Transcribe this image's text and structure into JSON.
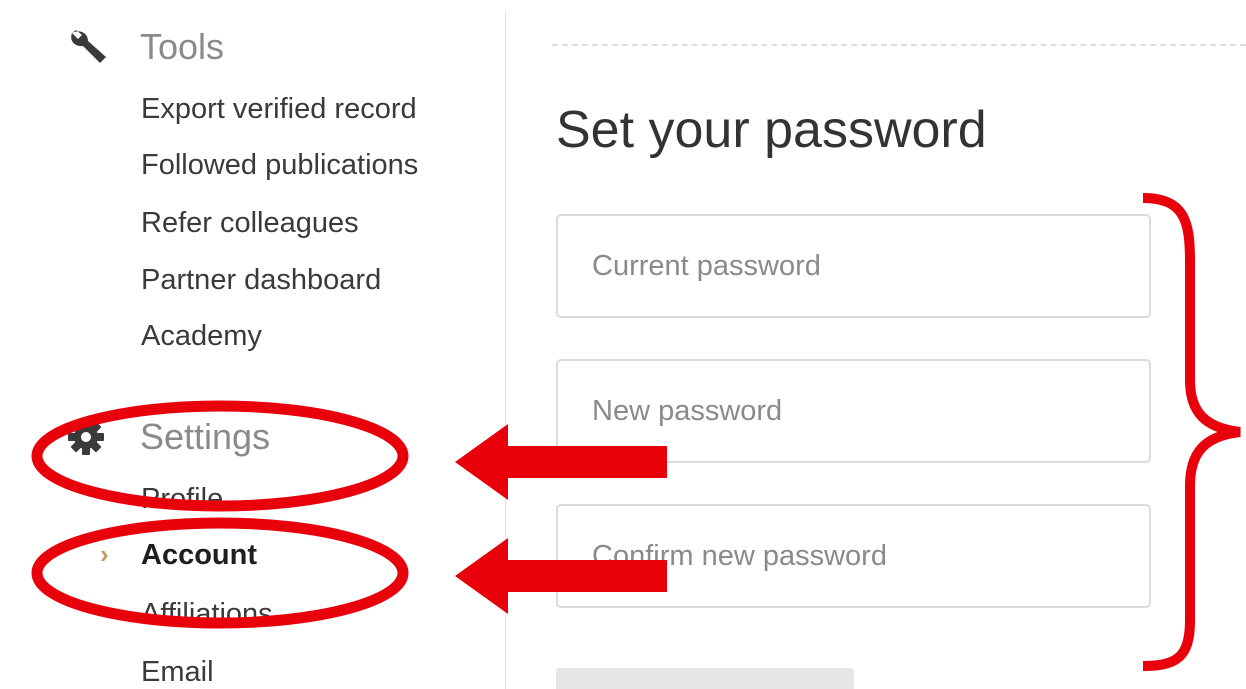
{
  "sidebar": {
    "tools": {
      "title": "Tools",
      "icon": "wrench-icon",
      "items": [
        {
          "label": "Export verified record"
        },
        {
          "label": "Followed publications"
        },
        {
          "label": "Refer colleagues"
        },
        {
          "label": "Partner dashboard"
        },
        {
          "label": "Academy"
        }
      ]
    },
    "settings": {
      "title": "Settings",
      "icon": "gear-icon",
      "items": [
        {
          "label": "Profile"
        },
        {
          "label": "Account",
          "active": true
        },
        {
          "label": "Affiliations"
        },
        {
          "label": "Email"
        }
      ]
    }
  },
  "main": {
    "title": "Set your password",
    "fields": {
      "current": {
        "placeholder": "Current password",
        "value": ""
      },
      "new": {
        "placeholder": "New password",
        "value": ""
      },
      "confirm": {
        "placeholder": "Confirm new password",
        "value": ""
      }
    }
  },
  "colors": {
    "annotation": "#e8000b",
    "active_chevron": "#c79a63",
    "section_heading": "#8a8a8a",
    "border": "#dcdcdc"
  }
}
